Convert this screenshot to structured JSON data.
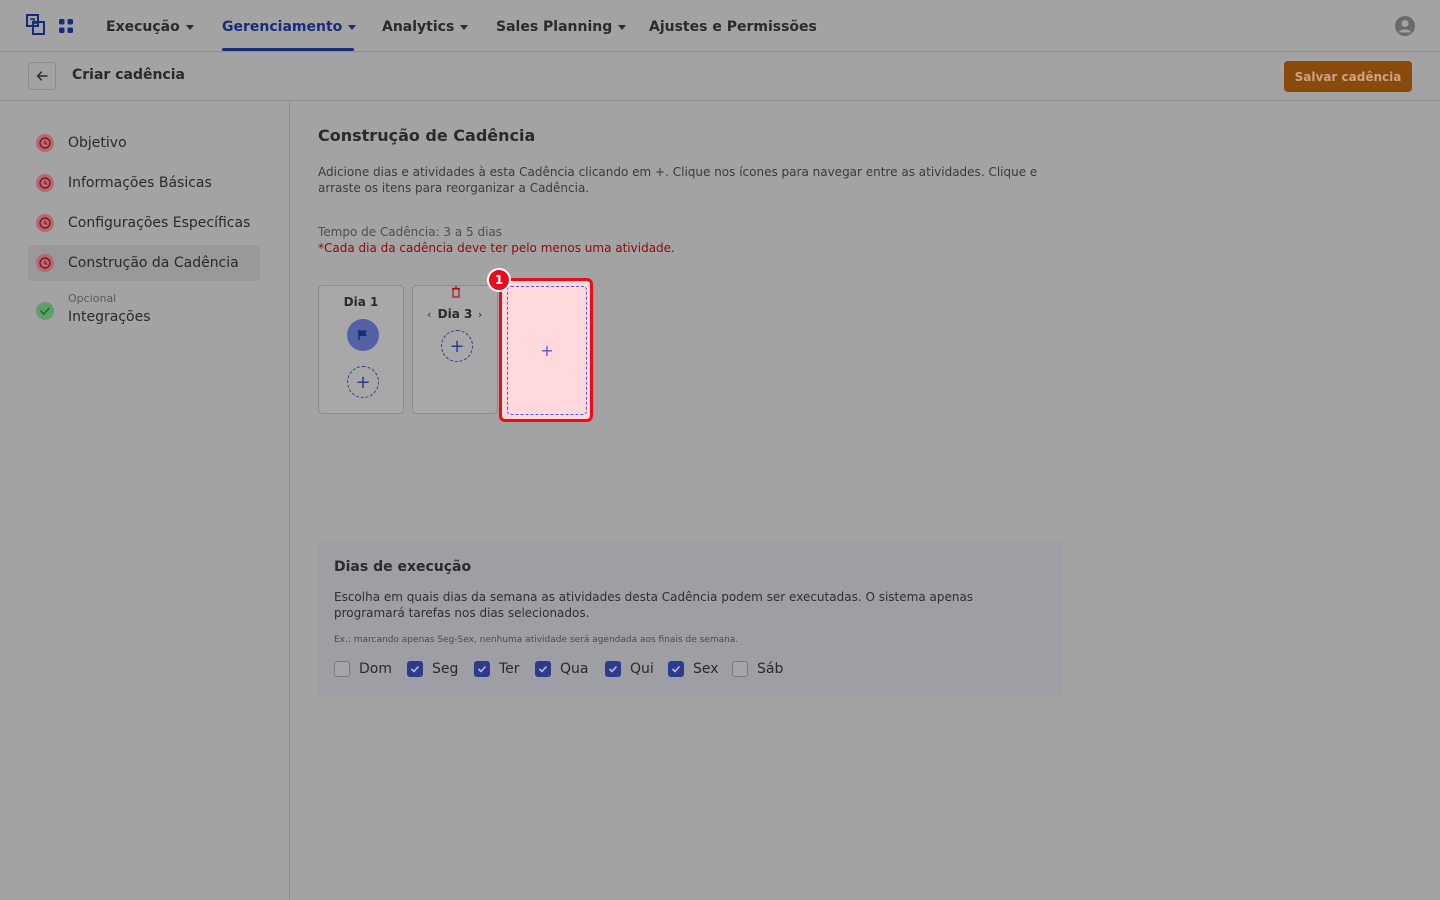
{
  "nav": {
    "items": [
      {
        "label": "Execução"
      },
      {
        "label": "Gerenciamento"
      },
      {
        "label": "Analytics"
      },
      {
        "label": "Sales Planning"
      },
      {
        "label": "Ajustes e Permissões"
      }
    ],
    "active_index": 1
  },
  "header": {
    "title": "Criar cadência",
    "save_label": "Salvar cadência"
  },
  "sidebar": {
    "items": [
      {
        "label": "Objetivo",
        "status": "incomplete"
      },
      {
        "label": "Informações Básicas",
        "status": "incomplete"
      },
      {
        "label": "Configurações Específicas",
        "status": "incomplete"
      },
      {
        "label": "Construção da Cadência",
        "status": "incomplete"
      },
      {
        "label": "Integrações",
        "sublabel": "Opcional",
        "status": "complete"
      }
    ]
  },
  "main": {
    "title": "Construção de Cadência",
    "description": "Adicione dias e atividades à esta Cadência clicando em +. Clique nos ícones para navegar entre as atividades. Clique e arraste os itens para reorganizar a Cadência.",
    "tempo": "Tempo de Cadência: 3 a 5 dias",
    "warning": "*Cada dia da cadência deve ter pelo menos uma atividade.",
    "days": [
      {
        "label": "Dia 1",
        "activity_icon": "flag-icon"
      },
      {
        "label": "Dia 3"
      }
    ],
    "add_symbol": "+",
    "callout_number": "1"
  },
  "execution": {
    "title": "Dias de execução",
    "description": "Escolha em quais dias da semana as atividades desta Cadência podem ser executadas. O sistema apenas programará tarefas nos dias selecionados.",
    "example": "Ex.: marcando apenas Seg-Sex, nenhuma atividade será agendada aos finais de semana.",
    "days": [
      {
        "label": "Dom",
        "checked": false
      },
      {
        "label": "Seg",
        "checked": true
      },
      {
        "label": "Ter",
        "checked": true
      },
      {
        "label": "Qua",
        "checked": true
      },
      {
        "label": "Qui",
        "checked": true
      },
      {
        "label": "Sex",
        "checked": true
      },
      {
        "label": "Sáb",
        "checked": false
      }
    ]
  },
  "colors": {
    "accent": "#1a2a7a",
    "save_button": "#8a4a0c",
    "warning": "#8a0b0b",
    "highlight": "#ea0c1c",
    "checkbox_on": "#2e3b8c"
  }
}
